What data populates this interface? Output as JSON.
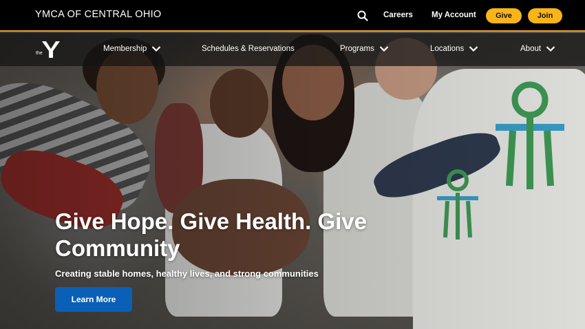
{
  "header": {
    "brand": "YMCA OF CENTRAL OHIO",
    "links": {
      "careers": "Careers",
      "my_account": "My Account"
    },
    "buttons": {
      "give": "Give",
      "join": "Join"
    },
    "icons": {
      "search": "search-icon"
    }
  },
  "nav": {
    "logo_text": "the",
    "items": [
      {
        "label": "Membership",
        "has_dropdown": true
      },
      {
        "label": "Schedules & Reservations",
        "has_dropdown": false
      },
      {
        "label": "Programs",
        "has_dropdown": true
      },
      {
        "label": "Locations",
        "has_dropdown": true
      },
      {
        "label": "About",
        "has_dropdown": true
      }
    ]
  },
  "hero": {
    "headline": "Give Hope. Give Health. Give Community",
    "subheadline": "Creating stable homes, healthy lives, and strong communities",
    "cta_label": "Learn More"
  },
  "colors": {
    "accent_yellow": "#f9b418",
    "cta_blue": "#0a5fb6",
    "topbar_bg": "#000000"
  }
}
